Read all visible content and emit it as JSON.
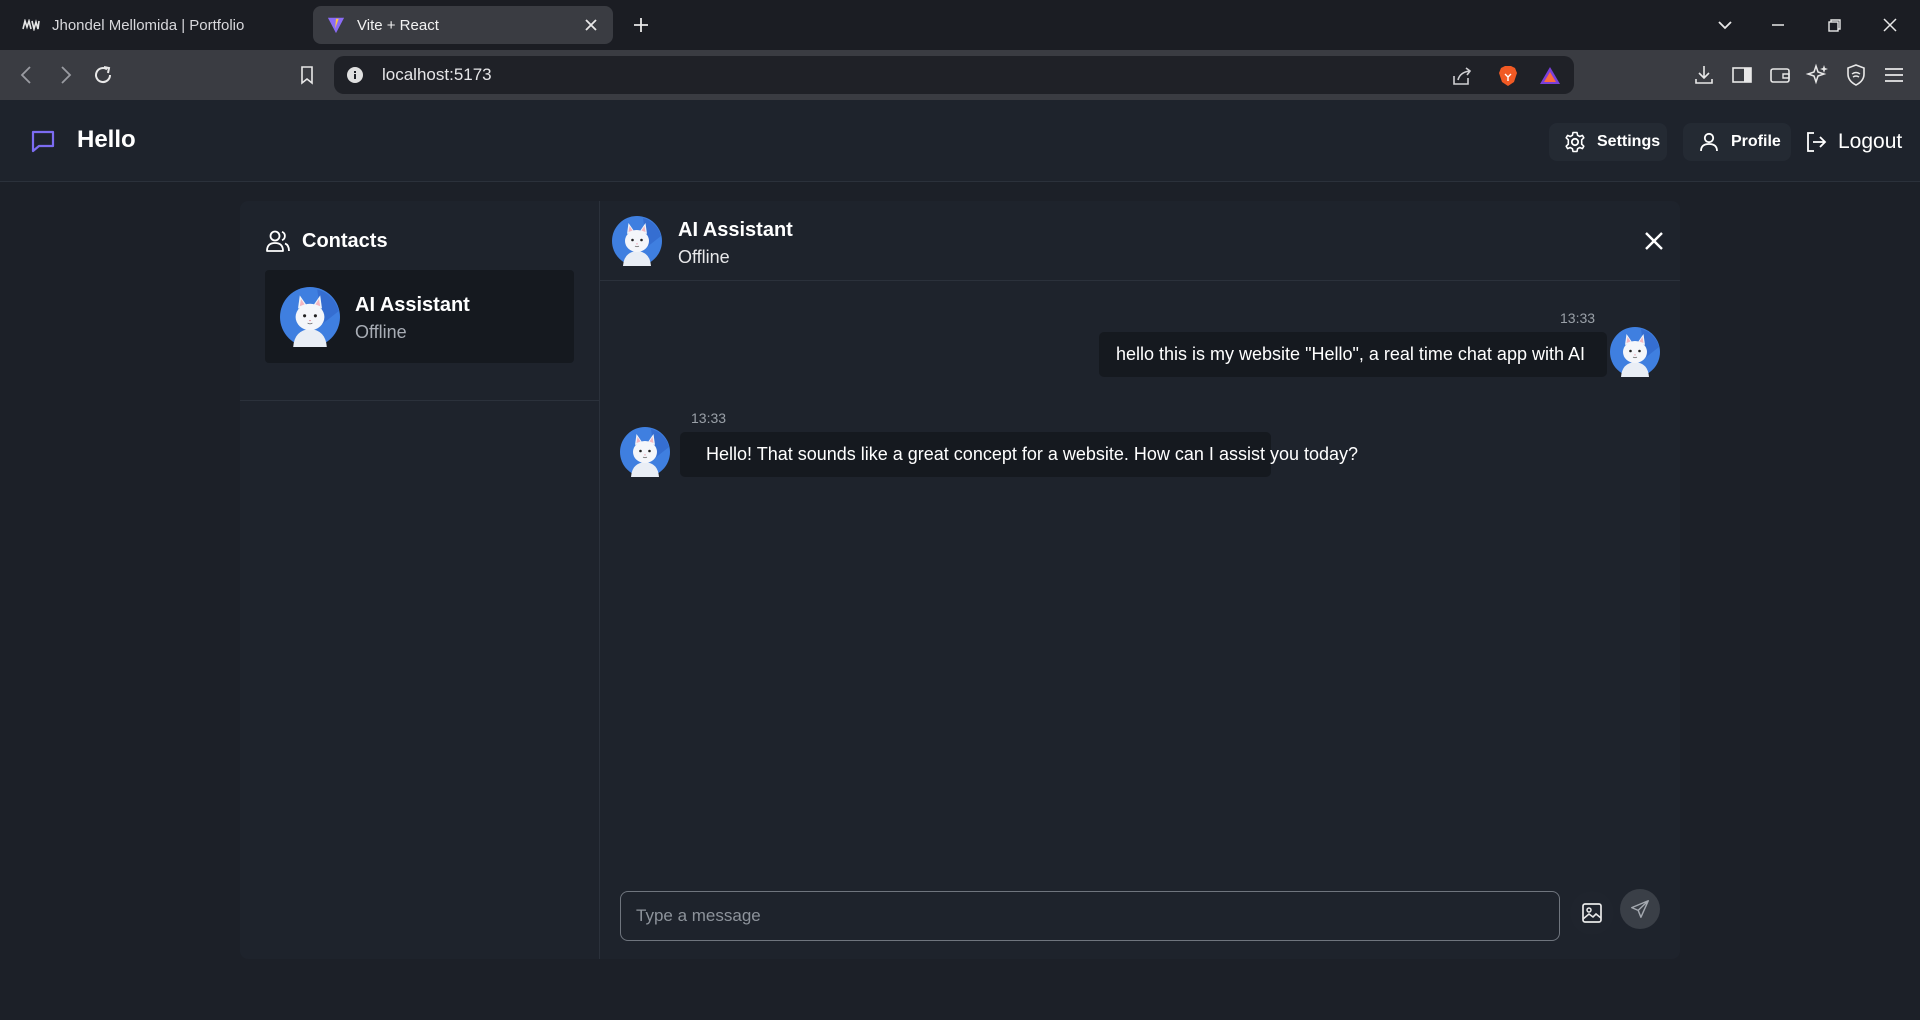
{
  "browser": {
    "tabs": [
      {
        "title": "Jhondel Mellomida | Portfolio",
        "favicon": "jm-logo-icon",
        "active": false
      },
      {
        "title": "Vite + React",
        "favicon": "vite-logo-icon",
        "active": true
      }
    ],
    "address": "localhost:5173"
  },
  "app": {
    "title": "Hello",
    "accent": "#7c6cf2",
    "header": {
      "settings_label": "Settings",
      "profile_label": "Profile",
      "logout_label": "Logout"
    }
  },
  "sidebar": {
    "title": "Contacts",
    "contacts": [
      {
        "name": "AI Assistant",
        "status": "Offline"
      }
    ]
  },
  "chat": {
    "contact_name": "AI Assistant",
    "contact_status": "Offline",
    "messages": [
      {
        "from": "me",
        "time": "13:33",
        "text": "hello this is my website \"Hello\", a real time chat app with AI"
      },
      {
        "from": "ai",
        "time": "13:33",
        "text": "Hello! That sounds like a great concept for a website. How can I assist you today?"
      }
    ],
    "input_placeholder": "Type a message"
  }
}
